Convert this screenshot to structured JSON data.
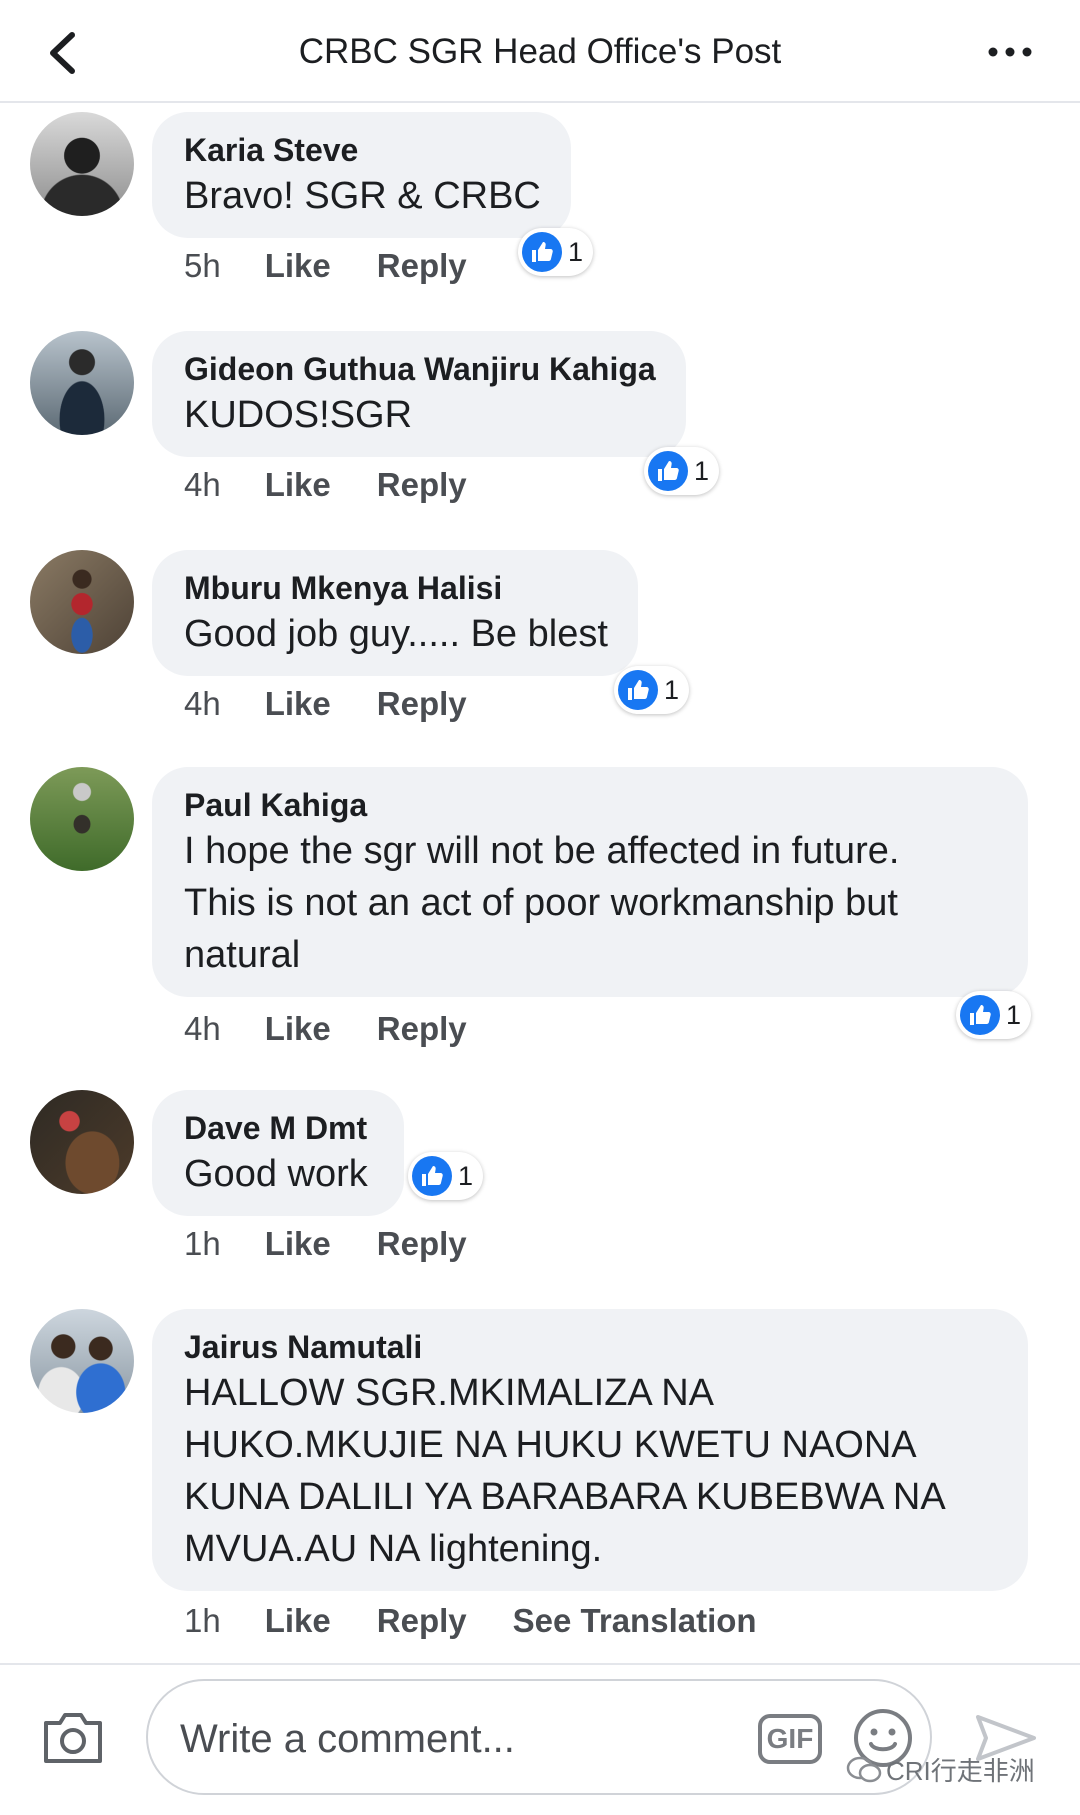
{
  "header": {
    "title": "CRBC SGR Head Office's Post"
  },
  "comments": [
    {
      "author": "Karia Steve",
      "text": "Bravo! SGR & CRBC",
      "time": "5h",
      "like_label": "Like",
      "reply_label": "Reply",
      "reactions": "1"
    },
    {
      "author": "Gideon Guthua Wanjiru Kahiga",
      "text": "KUDOS!SGR",
      "time": "4h",
      "like_label": "Like",
      "reply_label": "Reply",
      "reactions": "1"
    },
    {
      "author": "Mburu Mkenya Halisi",
      "text": "Good job guy..... Be blest",
      "time": "4h",
      "like_label": "Like",
      "reply_label": "Reply",
      "reactions": "1"
    },
    {
      "author": "Paul Kahiga",
      "text": "I hope the sgr will not be affected in future.\nThis is not an act of poor workmanship but\nnatural",
      "time": "4h",
      "like_label": "Like",
      "reply_label": "Reply",
      "reactions": "1"
    },
    {
      "author": "Dave M Dmt",
      "text": "Good work",
      "time": "1h",
      "like_label": "Like",
      "reply_label": "Reply",
      "reactions": "1"
    },
    {
      "author": "Jairus Namutali",
      "text": "HALLOW SGR.MKIMALIZA NA\nHUKO.MKUJIE NA HUKU KWETU NAONA\nKUNA DALILI YA BARABARA KUBEBWA NA\nMVUA.AU NA lightening.",
      "time": "1h",
      "like_label": "Like",
      "reply_label": "Reply",
      "translation_label": "See Translation"
    }
  ],
  "composer": {
    "placeholder": "Write a comment...",
    "gif_label": "GIF"
  },
  "watermark": "CRI行走非洲",
  "colors": {
    "like_blue": "#1877f2",
    "bubble_bg": "#f0f2f5",
    "text_primary": "#1c1e21",
    "text_secondary": "#4a4d52"
  }
}
